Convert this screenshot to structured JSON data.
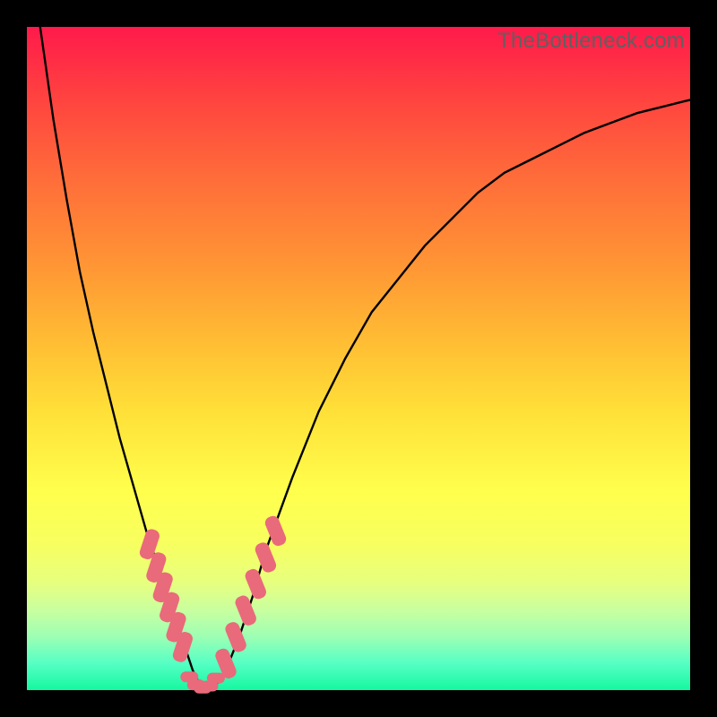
{
  "watermark": "TheBottleneck.com",
  "colors": {
    "frame": "#000000",
    "watermark": "#606060",
    "curve": "#000000",
    "marker": "#e96a7a",
    "gradient_top": "#ff1a4b",
    "gradient_bottom": "#14f8a0"
  },
  "chart_data": {
    "type": "line",
    "title": "",
    "xlabel": "",
    "ylabel": "",
    "xlim": [
      0,
      100
    ],
    "ylim": [
      0,
      100
    ],
    "grid": false,
    "legend": false,
    "annotations": [],
    "x": [
      0,
      2,
      4,
      6,
      8,
      10,
      12,
      14,
      16,
      18,
      20,
      21,
      22,
      23,
      24,
      25,
      26,
      27,
      28,
      30,
      32,
      34,
      36,
      40,
      44,
      48,
      52,
      56,
      60,
      64,
      68,
      72,
      76,
      80,
      84,
      88,
      92,
      96,
      100
    ],
    "values": [
      118,
      100,
      86,
      74,
      63,
      54,
      46,
      38,
      31,
      24,
      18,
      15,
      12,
      9,
      6,
      3,
      1,
      0,
      0,
      3,
      8,
      14,
      21,
      32,
      42,
      50,
      57,
      62,
      67,
      71,
      75,
      78,
      80,
      82,
      84,
      85.5,
      87,
      88,
      89
    ],
    "minimum_x": 26,
    "marker_clusters": {
      "left_branch_x": [
        18.5,
        19.5,
        20.5,
        21.5,
        22.5,
        23.5
      ],
      "left_branch_y": [
        22,
        18.5,
        15.5,
        12.5,
        9.5,
        6.5
      ],
      "right_branch_x": [
        30,
        31.5,
        33,
        34.5,
        36,
        37.5
      ],
      "right_branch_y": [
        4,
        8,
        12,
        16,
        20,
        24
      ],
      "bottom_x": [
        24.5,
        25.5,
        26.5,
        27.5,
        28.5
      ],
      "bottom_y": [
        2,
        0.8,
        0.3,
        0.6,
        1.8
      ]
    }
  }
}
